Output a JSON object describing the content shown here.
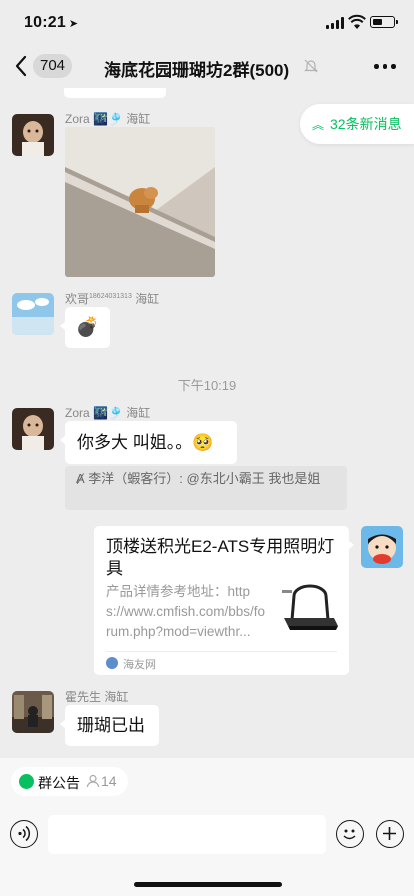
{
  "status_bar": {
    "time": "10:21",
    "location_arrow": "➤"
  },
  "nav": {
    "back_count": "704",
    "title": "海底花园珊瑚坊2群(500)"
  },
  "new_messages": "32条新消息",
  "messages": [
    {
      "sender": "Zora 🌃🎐 海缸",
      "type": "image"
    },
    {
      "sender_name": "欢哥",
      "sender_sup": "18624031313",
      "sender_suffix": "海缸",
      "text": "💣"
    },
    {
      "sender": "Zora 🌃🎐 海缸",
      "text": "你多大 叫姐。。🥺"
    },
    {
      "text": "珊瑚已出",
      "sender": "霍先生 海缸"
    }
  ],
  "time_divider": "下午10:19",
  "quote": "Ⱥ 李洋（蝦客行）: @东北小霸王 我也是姐",
  "link_card": {
    "title": "顶楼送积光E2-ATS专用照明灯具",
    "description": "产品详情参考地址：https://www.cmfish.com/bbs/forum.php?mod=viewthr...",
    "source": "海友网"
  },
  "announcement": {
    "label": "群公告",
    "count": "14"
  },
  "colors": {
    "accent": "#07c160",
    "background": "#ededed",
    "bubble": "#ffffff"
  },
  "icons": [
    "back-chevron-icon",
    "mute-bell-icon",
    "more-icon",
    "new-message-chevron-icon",
    "voice-icon",
    "emoji-icon",
    "plus-icon"
  ]
}
